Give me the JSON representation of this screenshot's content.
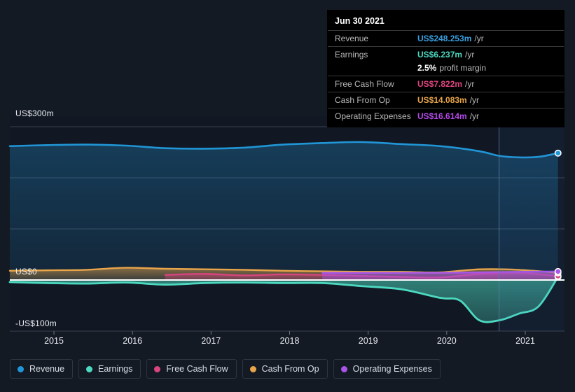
{
  "chart_data": {
    "type": "area",
    "title": "",
    "xlabel": "",
    "ylabel": "",
    "ylim": [
      -100,
      300
    ],
    "grid": true,
    "legend_position": "bottom",
    "y_ticks": [
      {
        "label": "US$300m",
        "value": 300
      },
      {
        "label": "US$0",
        "value": 0
      },
      {
        "label": "-US$100m",
        "value": -100
      }
    ],
    "x_ticks": [
      "2015",
      "2016",
      "2017",
      "2018",
      "2019",
      "2020",
      "2021"
    ],
    "x_range": [
      "2014-06",
      "2021-09"
    ],
    "forecast_divider": "2020-09",
    "series": [
      {
        "name": "Revenue",
        "color": "#2196d6",
        "x": [
          "2014-06",
          "2014-12",
          "2015-06",
          "2015-12",
          "2016-06",
          "2016-12",
          "2017-06",
          "2017-12",
          "2018-06",
          "2018-12",
          "2019-06",
          "2019-12",
          "2020-06",
          "2020-09",
          "2020-12",
          "2021-03",
          "2021-06"
        ],
        "values": [
          262,
          264,
          265,
          263,
          258,
          257,
          259,
          265,
          268,
          270,
          266,
          262,
          252,
          243,
          240,
          241,
          248.253
        ]
      },
      {
        "name": "Earnings",
        "color": "#4dd9c0",
        "x": [
          "2014-06",
          "2014-12",
          "2015-06",
          "2015-12",
          "2016-06",
          "2016-12",
          "2017-06",
          "2017-12",
          "2018-06",
          "2018-12",
          "2019-06",
          "2019-12",
          "2020-03",
          "2020-06",
          "2020-09",
          "2020-12",
          "2021-03",
          "2021-06"
        ],
        "values": [
          -4,
          -6,
          -7,
          -5,
          -9,
          -6,
          -5,
          -6,
          -6,
          -12,
          -18,
          -35,
          -40,
          -79,
          -79,
          -66,
          -52,
          6.237
        ]
      },
      {
        "name": "Free Cash Flow",
        "color": "#d6457d",
        "x": [
          "2016-06",
          "2016-12",
          "2017-06",
          "2017-12",
          "2018-06",
          "2018-12",
          "2019-06",
          "2019-12",
          "2020-06",
          "2020-12",
          "2021-06"
        ],
        "values": [
          10,
          12,
          9,
          11,
          10,
          8,
          6,
          5,
          12,
          14,
          7.822
        ]
      },
      {
        "name": "Cash From Op",
        "color": "#e8a54a",
        "x": [
          "2014-06",
          "2014-12",
          "2015-06",
          "2015-12",
          "2016-06",
          "2016-12",
          "2017-06",
          "2017-12",
          "2018-06",
          "2018-12",
          "2019-06",
          "2019-12",
          "2020-06",
          "2020-12",
          "2021-06"
        ],
        "values": [
          18,
          19,
          20,
          24,
          22,
          21,
          20,
          18,
          17,
          16,
          16,
          15,
          21,
          20,
          14.083
        ]
      },
      {
        "name": "Operating Expenses",
        "color": "#a855e8",
        "x": [
          "2018-06",
          "2018-12",
          "2019-06",
          "2019-12",
          "2020-06",
          "2020-12",
          "2021-06"
        ],
        "values": [
          14,
          14,
          14,
          14,
          15,
          16,
          16.614
        ]
      }
    ]
  },
  "tooltip": {
    "date": "Jun 30 2021",
    "rows": [
      {
        "label": "Revenue",
        "value": "US$248.253m",
        "unit": "/yr",
        "color": "#3a9fe0"
      },
      {
        "label": "Earnings",
        "value": "US$6.237m",
        "unit": "/yr",
        "color": "#4dd9c0"
      },
      {
        "label": "",
        "value": "2.5%",
        "unit": "profit margin",
        "color": "#ffffff"
      },
      {
        "label": "Free Cash Flow",
        "value": "US$7.822m",
        "unit": "/yr",
        "color": "#e0457d"
      },
      {
        "label": "Cash From Op",
        "value": "US$14.083m",
        "unit": "/yr",
        "color": "#e8a54a"
      },
      {
        "label": "Operating Expenses",
        "value": "US$16.614m",
        "unit": "/yr",
        "color": "#b44ae8"
      }
    ]
  },
  "legend": {
    "items": [
      {
        "label": "Revenue",
        "color": "#2196d6"
      },
      {
        "label": "Earnings",
        "color": "#4dd9c0"
      },
      {
        "label": "Free Cash Flow",
        "color": "#d6457d"
      },
      {
        "label": "Cash From Op",
        "color": "#e8a54a"
      },
      {
        "label": "Operating Expenses",
        "color": "#a855e8"
      }
    ]
  }
}
